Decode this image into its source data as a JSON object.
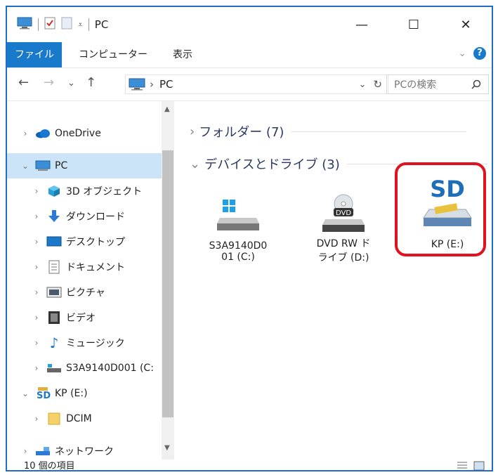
{
  "window": {
    "title": "PC"
  },
  "titlebar": {
    "minimize_glyph": "—",
    "maximize_glyph": "☐",
    "close_glyph": "✕"
  },
  "ribbon": {
    "tabs": [
      "ファイル",
      "コンピューター",
      "表示"
    ],
    "help_glyph": "?",
    "expand_glyph": "⌄"
  },
  "navigation": {
    "back": "←",
    "forward": "→",
    "recent": "⌄",
    "up": "↑",
    "path": "PC",
    "path_sep": "›",
    "dropdown": "⌄",
    "refresh": "↻",
    "search_placeholder": "PCの検索"
  },
  "tree": [
    {
      "label": "OneDrive",
      "icon": "cloud-icon",
      "chevron": "›",
      "selected": false
    },
    {
      "label": "PC",
      "icon": "computer-icon",
      "chevron": "⌄",
      "selected": true
    },
    {
      "label": "3D オブジェクト",
      "icon": "3d-objects-icon",
      "chevron": "›",
      "selected": false
    },
    {
      "label": "ダウンロード",
      "icon": "download-icon",
      "chevron": "›",
      "selected": false
    },
    {
      "label": "デスクトップ",
      "icon": "desktop-icon",
      "chevron": "›",
      "selected": false
    },
    {
      "label": "ドキュメント",
      "icon": "documents-icon",
      "chevron": "›",
      "selected": false
    },
    {
      "label": "ピクチャ",
      "icon": "pictures-icon",
      "chevron": "›",
      "selected": false
    },
    {
      "label": "ビデオ",
      "icon": "video-icon",
      "chevron": "›",
      "selected": false
    },
    {
      "label": "ミュージック",
      "icon": "music-icon",
      "chevron": "›",
      "selected": false
    },
    {
      "label": "S3A9140D001 (C:",
      "icon": "drive-icon",
      "chevron": "›",
      "selected": false
    },
    {
      "label": "KP (E:)",
      "icon": "sd-card-icon",
      "chevron": "⌄",
      "selected": false
    },
    {
      "label": "DCIM",
      "icon": "folder-icon",
      "chevron": "›",
      "selected": false
    },
    {
      "label": "ネットワーク",
      "icon": "network-icon",
      "chevron": "›",
      "selected": false
    }
  ],
  "content": {
    "folders_header": "フォルダー (7)",
    "folders_chevron": "›",
    "devices_header": "デバイスとドライブ (3)",
    "devices_chevron": "⌄",
    "drives": [
      {
        "label": "S3A9140D0\n01 (C:)",
        "icon": "windows-drive-icon"
      },
      {
        "label": "DVD RW ド\nライブ (D:)",
        "icon": "dvd-drive-icon",
        "badge": "DVD"
      },
      {
        "label": "KP (E:)",
        "icon": "sd-card-drive-icon",
        "badge": "SD"
      }
    ]
  },
  "status": {
    "count": "10 個の項目"
  }
}
